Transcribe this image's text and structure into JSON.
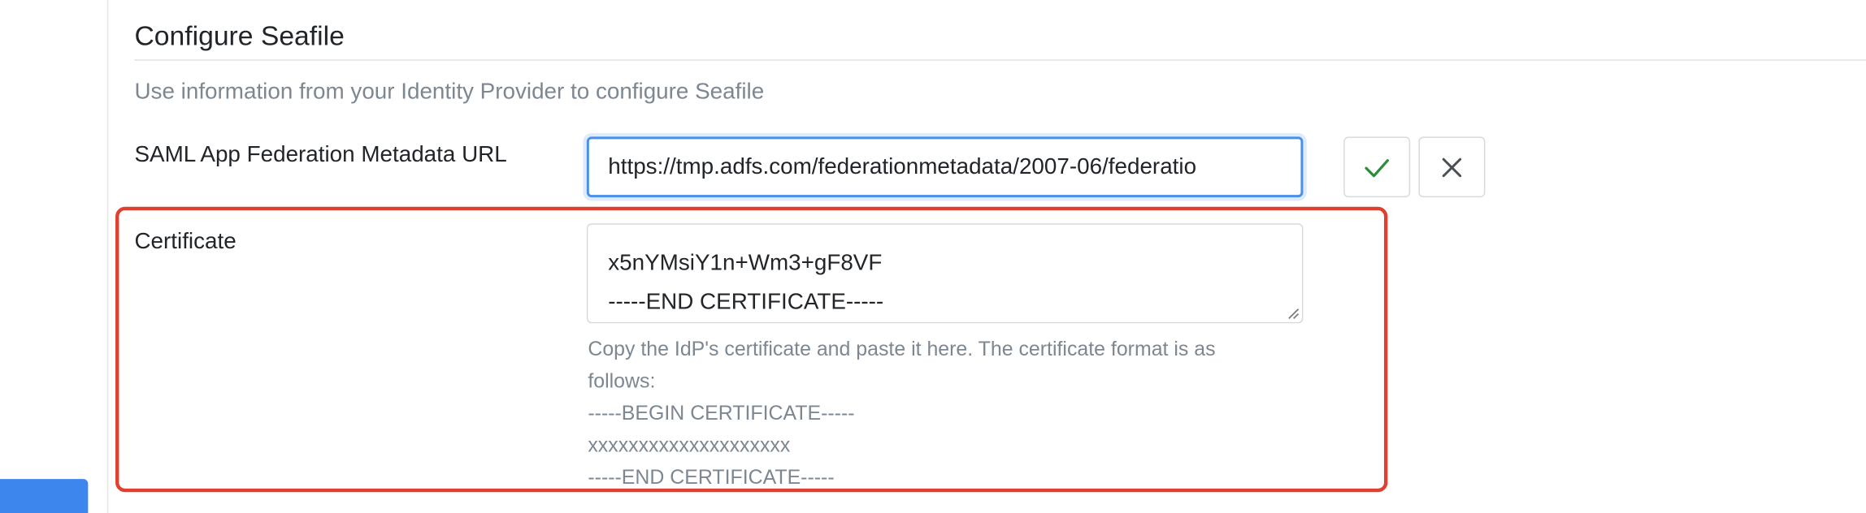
{
  "section": {
    "title": "Configure Seafile",
    "subtitle": "Use information from your Identity Provider to configure Seafile"
  },
  "metadata_url": {
    "label": "SAML App Federation Metadata URL",
    "value": "https://tmp.adfs.com/federationmetadata/2007-06/federatio",
    "confirm_icon": "check-icon",
    "cancel_icon": "close-icon"
  },
  "certificate": {
    "label": "Certificate",
    "visible_lines": [
      "x5nYMsiY1n+Wm3+gF8VF",
      "-----END CERTIFICATE-----"
    ],
    "help_lines": [
      "Copy the IdP's certificate and paste it here. The certificate format is as",
      "follows:",
      "-----BEGIN CERTIFICATE-----",
      "xxxxxxxxxxxxxxxxxxxx",
      "-----END CERTIFICATE-----"
    ]
  },
  "colors": {
    "accent": "#4a8fe8",
    "confirm": "#2e8b3e",
    "highlight": "#e0402f",
    "rail_button": "#3d86ee"
  }
}
